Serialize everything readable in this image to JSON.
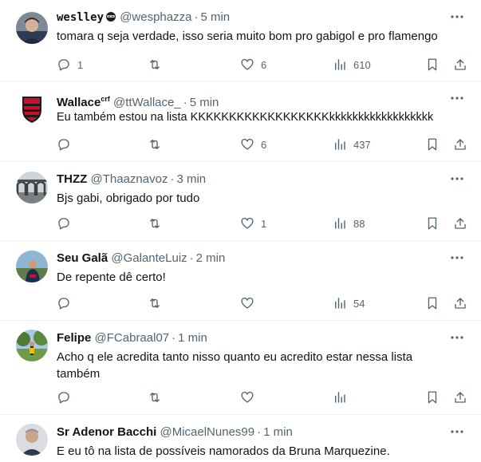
{
  "tweets": [
    {
      "name": "weslley",
      "handle": "@wesphazza",
      "time": "5 min",
      "text": "tomara q seja verdade, isso seria muito bom pro gabigol e pro flamengo",
      "replies": "1",
      "likes": "6",
      "views": "610",
      "avatar": "avatar-portrait",
      "badge": "ninja-emoji"
    },
    {
      "name": "Wallace",
      "name_suffix": "crf",
      "handle": "@ttWallace_",
      "time": "5 min",
      "text": "Eu também estou na lista KKKKKKKKKKKKKKKKKKkkkkkkkkkkkkkkkkkk",
      "replies": "",
      "likes": "6",
      "views": "437",
      "avatar": "flamengo-crest"
    },
    {
      "name": "THZZ",
      "handle": "@Thaaznavoz",
      "time": "3 min",
      "text": "Bjs gabi, obrigado por tudo",
      "replies": "",
      "likes": "1",
      "views": "88",
      "avatar": "avatar-arches"
    },
    {
      "name": "Seu Galã",
      "handle": "@GalanteLuiz",
      "time": "2 min",
      "text": "De repente dê certo!",
      "replies": "",
      "likes": "",
      "views": "54",
      "avatar": "avatar-outdoor"
    },
    {
      "name": "Felipe",
      "handle": "@FCabraal07",
      "time": "1 min",
      "text": "Acho q ele acredita tanto nisso quanto eu acredito estar nessa lista também",
      "replies": "",
      "likes": "",
      "views": "",
      "avatar": "avatar-park"
    },
    {
      "name": "Sr Adenor Bacchi",
      "handle": "@MicaelNunes99",
      "time": "1 min",
      "text": "E eu tô na lista de possíveis namorados da Bruna Marquezine.",
      "avatar": "avatar-man"
    }
  ],
  "separator": "·",
  "colors": {
    "text": "#0f1419",
    "secondary": "#536471",
    "border": "#eff3f4",
    "flamengo_red": "#c8102e"
  }
}
